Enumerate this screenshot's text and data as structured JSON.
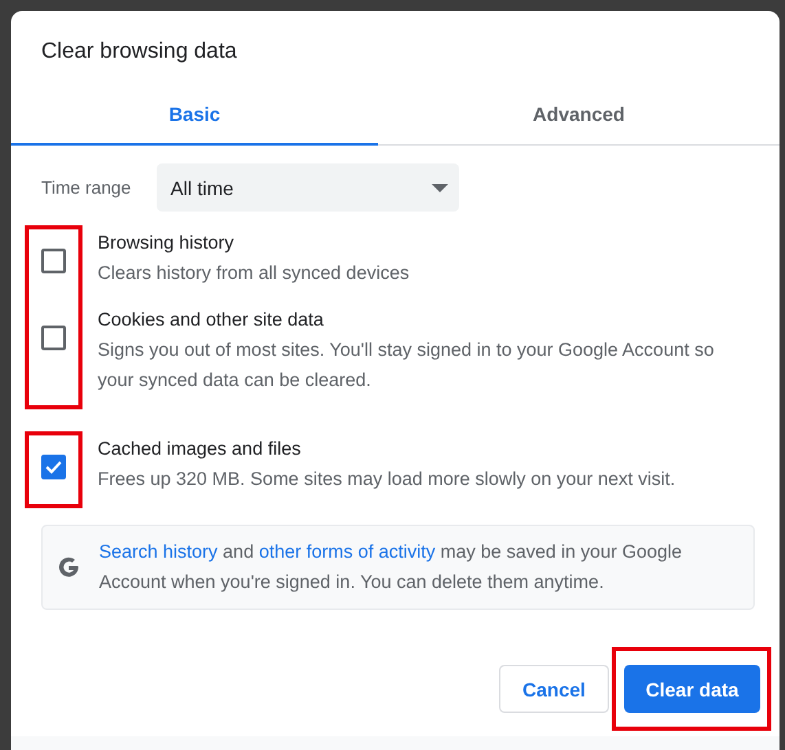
{
  "dialog": {
    "title": "Clear browsing data"
  },
  "tabs": [
    {
      "label": "Basic",
      "selected": true
    },
    {
      "label": "Advanced",
      "selected": false
    }
  ],
  "time_range": {
    "label": "Time range",
    "value": "All time"
  },
  "option_groups": [
    {
      "highlighted": true,
      "options": [
        {
          "title": "Browsing history",
          "description": "Clears history from all synced devices",
          "checked": false
        },
        {
          "title": "Cookies and other site data",
          "description": "Signs you out of most sites. You'll stay signed in to your Google Account so your synced data can be cleared.",
          "checked": false
        }
      ]
    },
    {
      "highlighted": true,
      "options": [
        {
          "title": "Cached images and files",
          "description": "Frees up 320 MB. Some sites may load more slowly on your next visit.",
          "checked": true
        }
      ]
    }
  ],
  "info": {
    "link_1": "Search history",
    "text_1": "and",
    "link_2": "other forms of activity",
    "text_2": "may be saved in your Google Account when you're signed in. You can delete them anytime."
  },
  "buttons": [
    {
      "label": "Cancel",
      "kind": "secondary",
      "highlighted": false
    },
    {
      "label": "Clear data",
      "kind": "primary",
      "highlighted": true
    }
  ]
}
